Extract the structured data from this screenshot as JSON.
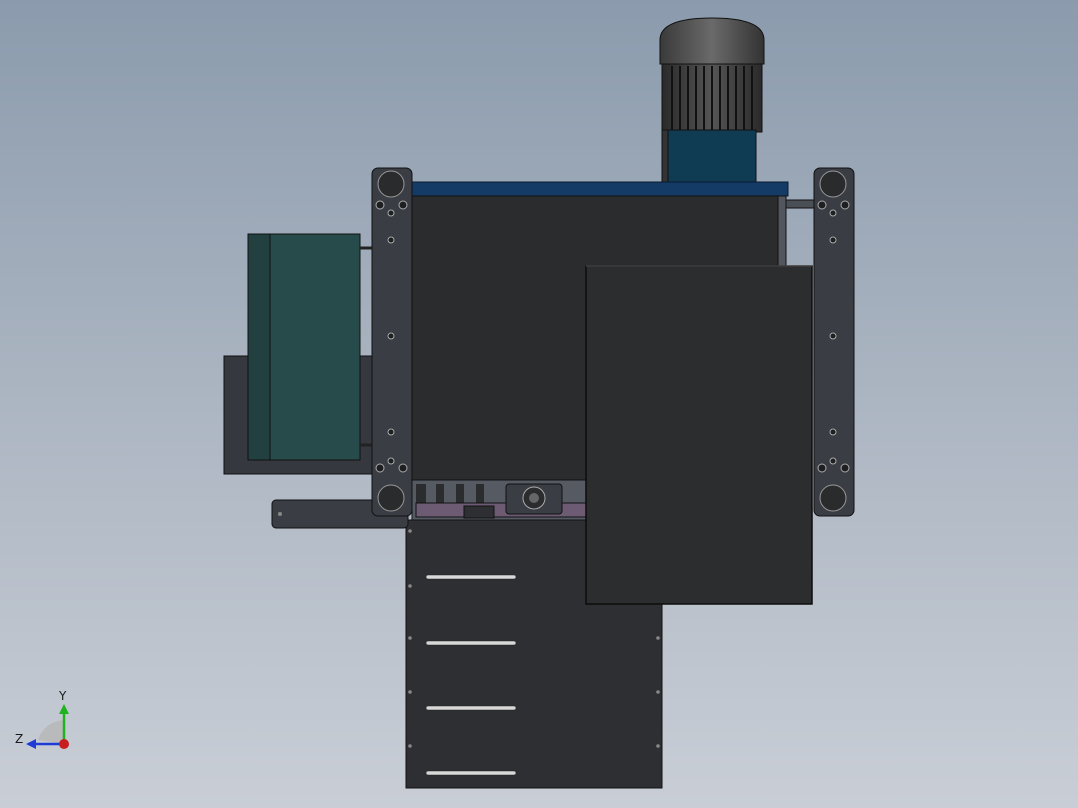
{
  "window": {
    "title": ""
  },
  "colors": {
    "background_top": "#8b9bad",
    "background_bottom": "#c9ced6",
    "machine_dark": "#2a2c2e",
    "frame_gray": "#3a3d44",
    "guard_green": "#274b4a",
    "motor_teal": "#0f3c52",
    "header_blue": "#143a66",
    "axis_x": "#c81e1e",
    "axis_y": "#1fb31f",
    "axis_z": "#1f3bd6"
  },
  "triad": {
    "y_label": "Y",
    "z_label": "Z"
  },
  "components": [
    "motor-icon",
    "main-housing",
    "side-guard",
    "left-column",
    "right-column",
    "front-door",
    "lower-panel",
    "feed-mechanism"
  ]
}
